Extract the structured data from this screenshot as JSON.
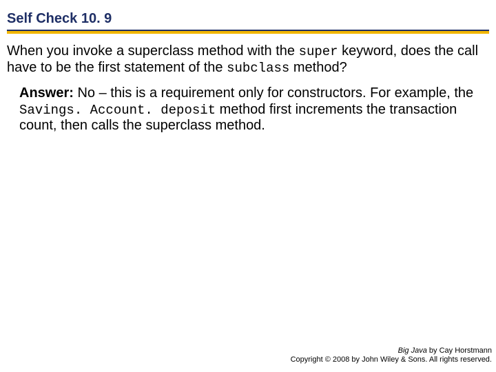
{
  "heading": "Self Check 10. 9",
  "question": {
    "part1": "When you invoke a superclass method with the ",
    "code1": "super",
    "part2": " keyword, does the call have to be the first statement of the ",
    "code2": "subclass",
    "part3": " method?"
  },
  "answer": {
    "label": "Answer:",
    "part1": " No – this is a requirement only for constructors. For example, the ",
    "code1": "Savings. Account. deposit",
    "part2": " method first increments the transaction count, then calls the superclass method."
  },
  "footer": {
    "book": "Big Java",
    "author": " by Cay Horstmann",
    "copyright": "Copyright © 2008 by John Wiley & Sons. All rights reserved."
  }
}
